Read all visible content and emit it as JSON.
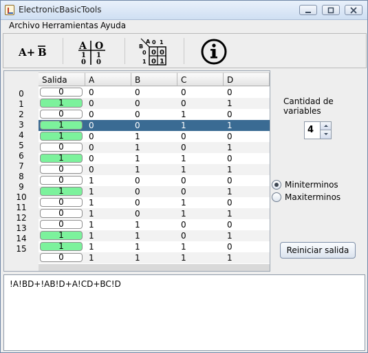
{
  "window": {
    "title": "ElectronicBasicTools"
  },
  "menu": {
    "items": [
      "Archivo",
      "Herramientas",
      "Ayuda"
    ]
  },
  "toolbar": {
    "tools": [
      {
        "name": "boolean-expression-tool",
        "icon": "boolean-expression-icon",
        "text": "A+B̅"
      },
      {
        "name": "truth-table-tool",
        "icon": "truth-table-icon"
      },
      {
        "name": "karnaugh-map-tool",
        "icon": "karnaugh-map-icon"
      },
      {
        "name": "info-tool",
        "icon": "info-icon"
      }
    ]
  },
  "table": {
    "columns": [
      "Salida",
      "A",
      "B",
      "C",
      "D"
    ],
    "row_indices": [
      "0",
      "1",
      "2",
      "3",
      "4",
      "5",
      "6",
      "7",
      "8",
      "9",
      "10",
      "11",
      "12",
      "13",
      "14",
      "15"
    ],
    "selected_row": 3,
    "rows": [
      {
        "salida": "0",
        "on": false,
        "a": "0",
        "b": "0",
        "c": "0",
        "d": "0"
      },
      {
        "salida": "1",
        "on": true,
        "a": "0",
        "b": "0",
        "c": "0",
        "d": "1"
      },
      {
        "salida": "0",
        "on": false,
        "a": "0",
        "b": "0",
        "c": "1",
        "d": "0"
      },
      {
        "salida": "1",
        "on": true,
        "a": "0",
        "b": "0",
        "c": "1",
        "d": "1"
      },
      {
        "salida": "1",
        "on": true,
        "a": "0",
        "b": "1",
        "c": "0",
        "d": "0"
      },
      {
        "salida": "0",
        "on": false,
        "a": "0",
        "b": "1",
        "c": "0",
        "d": "1"
      },
      {
        "salida": "1",
        "on": true,
        "a": "0",
        "b": "1",
        "c": "1",
        "d": "0"
      },
      {
        "salida": "0",
        "on": false,
        "a": "0",
        "b": "1",
        "c": "1",
        "d": "1"
      },
      {
        "salida": "0",
        "on": false,
        "a": "1",
        "b": "0",
        "c": "0",
        "d": "0"
      },
      {
        "salida": "1",
        "on": true,
        "a": "1",
        "b": "0",
        "c": "0",
        "d": "1"
      },
      {
        "salida": "0",
        "on": false,
        "a": "1",
        "b": "0",
        "c": "1",
        "d": "0"
      },
      {
        "salida": "0",
        "on": false,
        "a": "1",
        "b": "0",
        "c": "1",
        "d": "1"
      },
      {
        "salida": "0",
        "on": false,
        "a": "1",
        "b": "1",
        "c": "0",
        "d": "0"
      },
      {
        "salida": "1",
        "on": true,
        "a": "1",
        "b": "1",
        "c": "0",
        "d": "1"
      },
      {
        "salida": "1",
        "on": true,
        "a": "1",
        "b": "1",
        "c": "1",
        "d": "0"
      },
      {
        "salida": "0",
        "on": false,
        "a": "1",
        "b": "1",
        "c": "1",
        "d": "1"
      }
    ]
  },
  "controls": {
    "variables_label": "Cantidad de variables",
    "variables_value": "4",
    "mode_options": [
      "Miniterminos",
      "Maxiterminos"
    ],
    "mode_selected": "Miniterminos",
    "reset_label": "Reiniciar salida"
  },
  "expression": {
    "text": "!A!BD+!AB!D+A!CD+BC!D"
  },
  "colors": {
    "output_on": "#7cf29c",
    "selected_row": "#3a6b93",
    "accent": "#6f86a6"
  }
}
